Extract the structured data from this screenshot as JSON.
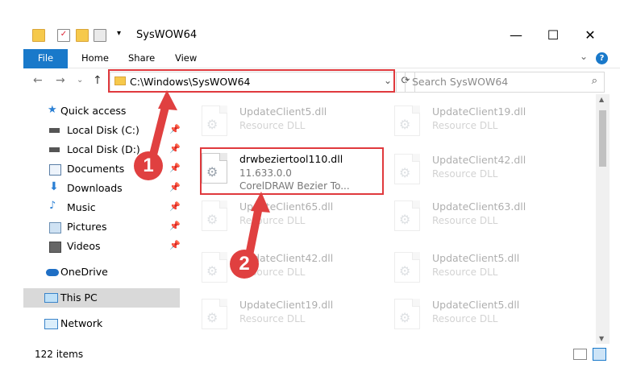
{
  "window": {
    "title": "SysWOW64",
    "minimize": "—",
    "maximize": "☐",
    "close": "✕"
  },
  "ribbon": {
    "tabs": [
      "File",
      "Home",
      "Share",
      "View"
    ],
    "help": "?",
    "expand": "⌄"
  },
  "address": {
    "path": "C:\\Windows\\SysWOW64",
    "search_placeholder": "Search SysWOW64"
  },
  "sidebar": {
    "items": [
      {
        "label": "Quick access",
        "icon": "star-icon",
        "pinned": false
      },
      {
        "label": "Local Disk (C:)",
        "icon": "drive-icon",
        "pinned": true
      },
      {
        "label": "Local Disk (D:)",
        "icon": "drive-icon",
        "pinned": true
      },
      {
        "label": "Documents",
        "icon": "documents-icon",
        "pinned": true
      },
      {
        "label": "Downloads",
        "icon": "download-icon",
        "pinned": true
      },
      {
        "label": "Music",
        "icon": "music-icon",
        "pinned": true
      },
      {
        "label": "Pictures",
        "icon": "pictures-icon",
        "pinned": true
      },
      {
        "label": "Videos",
        "icon": "videos-icon",
        "pinned": true
      },
      {
        "label": "OneDrive",
        "icon": "cloud-icon",
        "pinned": false
      },
      {
        "label": "This PC",
        "icon": "computer-icon",
        "pinned": false
      },
      {
        "label": "Network",
        "icon": "network-icon",
        "pinned": false
      }
    ]
  },
  "files": {
    "left": [
      {
        "name": "UpdateClient5.dll",
        "line2": "Resource DLL",
        "faded": true
      },
      {
        "name": "drwbeziertool110.dll",
        "line2": "11.633.0.0",
        "line3": "CorelDRAW Bezier To...",
        "faded": false
      },
      {
        "name": "UpdateClient65.dll",
        "line2": "Resource DLL",
        "faded": true
      },
      {
        "name": "UpdateClient42.dll",
        "line2": "Resource DLL",
        "faded": true
      },
      {
        "name": "UpdateClient19.dll",
        "line2": "Resource DLL",
        "faded": true
      }
    ],
    "right": [
      {
        "name": "UpdateClient19.dll",
        "line2": "Resource DLL",
        "faded": true
      },
      {
        "name": "UpdateClient42.dll",
        "line2": "Resource DLL",
        "faded": true
      },
      {
        "name": "UpdateClient63.dll",
        "line2": "Resource DLL",
        "faded": true
      },
      {
        "name": "UpdateClient5.dll",
        "line2": "Resource DLL",
        "faded": true
      },
      {
        "name": "UpdateClient5.dll",
        "line2": "Resource DLL",
        "faded": true
      }
    ]
  },
  "status": {
    "count": "122 items"
  },
  "annotations": {
    "marker1": "1",
    "marker2": "2"
  },
  "colors": {
    "accent": "#1979ca",
    "highlight": "#e0393d"
  }
}
